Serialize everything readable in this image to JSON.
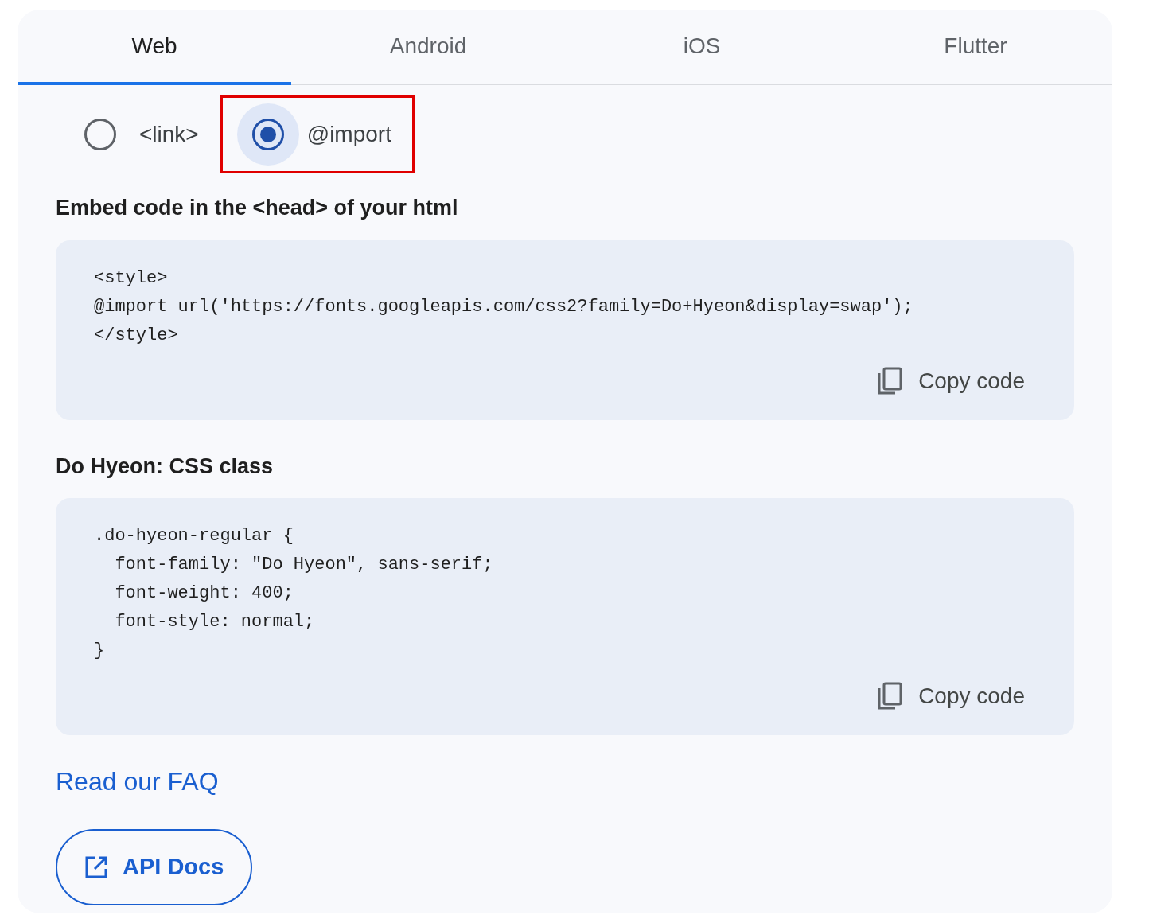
{
  "tabs": [
    {
      "label": "Web",
      "selected": true
    },
    {
      "label": "Android",
      "selected": false
    },
    {
      "label": "iOS",
      "selected": false
    },
    {
      "label": "Flutter",
      "selected": false
    }
  ],
  "embed_options": [
    {
      "label": "<link>",
      "selected": false,
      "highlighted": false
    },
    {
      "label": "@import",
      "selected": true,
      "highlighted": true
    }
  ],
  "sections": [
    {
      "heading": "Embed code in the <head> of your html",
      "code": "<style>\n@import url('https://fonts.googleapis.com/css2?family=Do+Hyeon&display=swap');\n</style>",
      "copy_label": "Copy code"
    },
    {
      "heading": "Do Hyeon: CSS class",
      "code": ".do-hyeon-regular {\n  font-family: \"Do Hyeon\", sans-serif;\n  font-weight: 400;\n  font-style: normal;\n}",
      "copy_label": "Copy code"
    }
  ],
  "faq_link": "Read our FAQ",
  "api_docs_button": "API Docs"
}
